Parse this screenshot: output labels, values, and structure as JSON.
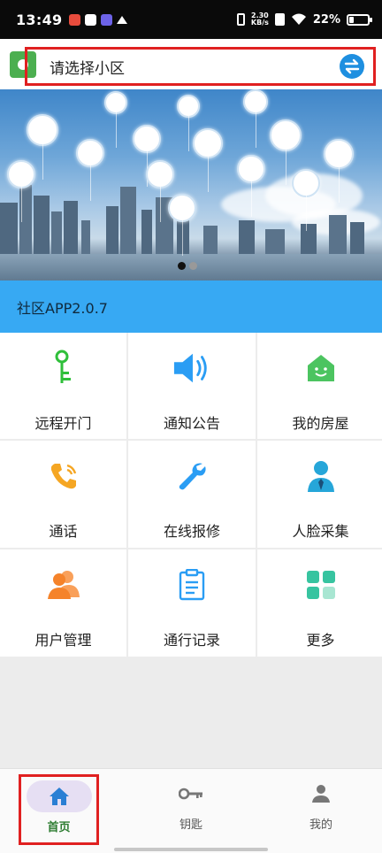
{
  "status_bar": {
    "time": "13:49",
    "net_speed_value": "2.30",
    "net_speed_unit": "KB/s",
    "battery": "22%",
    "battery_level": 0.22
  },
  "header": {
    "community_placeholder": "请选择小区",
    "switch_icon": "swap-arrows-icon"
  },
  "banner": {
    "slide_count": 2,
    "active_slide": 1
  },
  "version_bar": {
    "text": "社区APP2.0.7"
  },
  "grid": [
    {
      "label": "远程开门",
      "icon": "key-icon",
      "color": "#2fbf3a"
    },
    {
      "label": "通知公告",
      "icon": "speaker-icon",
      "color": "#2a9df4"
    },
    {
      "label": "我的房屋",
      "icon": "house-icon",
      "color": "#4cc460"
    },
    {
      "label": "通话",
      "icon": "phone-icon",
      "color": "#f5a623"
    },
    {
      "label": "在线报修",
      "icon": "wrench-icon",
      "color": "#2a9df4"
    },
    {
      "label": "人脸采集",
      "icon": "person-icon",
      "color": "#26a6d9"
    },
    {
      "label": "用户管理",
      "icon": "users-icon",
      "color": "#f5832a"
    },
    {
      "label": "通行记录",
      "icon": "clipboard-icon",
      "color": "#2a9df4"
    },
    {
      "label": "更多",
      "icon": "apps-grid-icon",
      "color": "#37c4a0"
    }
  ],
  "tabs": [
    {
      "label": "首页",
      "icon": "home-icon",
      "active": true
    },
    {
      "label": "钥匙",
      "icon": "key-icon",
      "active": false
    },
    {
      "label": "我的",
      "icon": "person-icon",
      "active": false
    }
  ],
  "colors": {
    "accent_blue": "#37a9f3",
    "active_tab": "#2e7d32",
    "highlight_red": "#e02020"
  }
}
